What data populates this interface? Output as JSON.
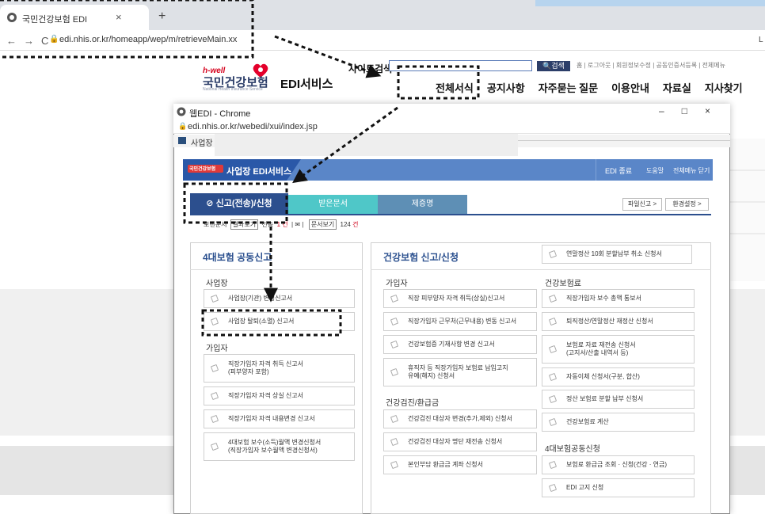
{
  "back_browser": {
    "tab_title": "국민건강보험 EDI",
    "url": "edi.nhis.or.kr/homeapp/wep/m/retrieveMain.xx",
    "cut_letter": "L"
  },
  "site": {
    "logo_brand": "h-well",
    "logo_name": "국민건강보험",
    "logo_sub": "National Health Insurance Service",
    "logo_service": "EDI서비스",
    "search_label": "사이트검색",
    "search_button": "검색",
    "top_links": "홈 | 로그아웃 | 회원정보수정 | 공동인증서등록 | 전체메뉴",
    "gnb": [
      "전체서식",
      "공지사항",
      "자주묻는 질문",
      "이용안내",
      "자료실",
      "지사찾기"
    ]
  },
  "popup": {
    "title": "웹EDI - Chrome",
    "url": "edi.nhis.or.kr/webedi/xui/index.jsp",
    "crumb": "사업장",
    "window_controls": [
      "–",
      "□",
      "×"
    ],
    "edi_logo": "국민건강보험",
    "edi_title": "사업장 EDI서비스",
    "edi_end": "EDI 종료",
    "help": "도움말",
    "close_all": "전체메뉴 닫기",
    "tabs": [
      "신고(전송)/신청",
      "받은문서",
      "제증명"
    ],
    "file_report": "파일신고 >",
    "env_settings": "환경설정 >",
    "status": {
      "sent": "보낸문서",
      "results": "결과보기",
      "sent_count_label": "전송",
      "sent_count": "1 건",
      "doc_view": "문서보기",
      "doc_count_prefix": "124",
      "doc_count": "건"
    },
    "left_panel": {
      "title": "4대보험 공동신고",
      "section1": "사업장",
      "items1": [
        "사업장(기관) 변경신고서",
        "사업장 탈퇴(소멸) 신고서"
      ],
      "section2": "가입자",
      "items2": [
        "직장가입자 자격 취득 신고서\n(피부양자 포함)",
        "직장가입자 자격 상실 신고서",
        "직장가입자 자격 내용변경 신고서",
        "4대보험 보수(소득)월액 변경신청서\n(직장가입자 보수월액 변경신청서)"
      ]
    },
    "mid_panel": {
      "title": "건강보험 신고/신청",
      "top_item": "연말정산 10회 분할납부 취소 신청서",
      "col1_section1": "가입자",
      "col1_items1": [
        "직장 피부양자 자격 취득(상실)신고서",
        "직장가입자 근무처(근무내용) 변동 신고서",
        "건강보험증 기재사항 변경 신고서",
        "휴직자 등 직장가입자 보험료 납입고지\n유예(해지) 신청서"
      ],
      "col1_section2": "건강검진/환급금",
      "col1_items2": [
        "건강검진 대상자 변경(추가,제외) 신청서",
        "건강검진 대상자 명단 재전송 신청서",
        "본인부담 환급금 계좌 신청서"
      ],
      "col2_section1": "건강보험료",
      "col2_items1": [
        "직장가입자 보수 총액 통보서",
        "퇴직정산/연말정산 재정산 신청서",
        "보험료 자료 재전송 신청서\n(고지서/산출 내역서 등)",
        "자동이체 신청서(구분, 합산)",
        "정산 보험료 분할 납부 신청서",
        "건강보험료 계산"
      ],
      "col2_section2": "4대보험공동신청",
      "col2_items2": [
        "보험료 환급금 조회 · 신청(건강 · 연금)",
        "EDI 고지 신청"
      ]
    }
  }
}
